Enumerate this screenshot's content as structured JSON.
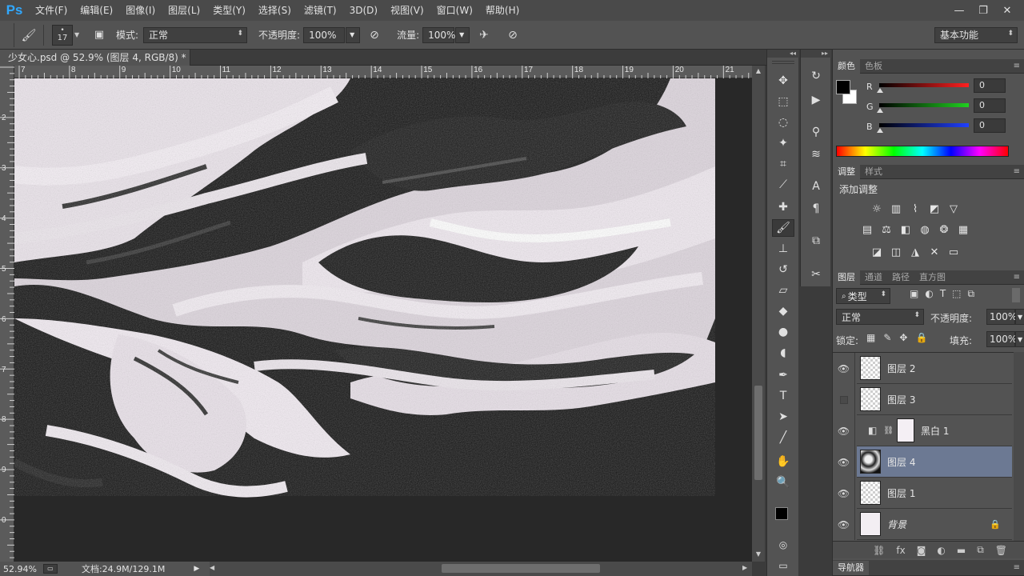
{
  "menu": {
    "logo": "Ps",
    "items": [
      "文件(F)",
      "编辑(E)",
      "图像(I)",
      "图层(L)",
      "类型(Y)",
      "选择(S)",
      "滤镜(T)",
      "3D(D)",
      "视图(V)",
      "窗口(W)",
      "帮助(H)"
    ],
    "window_controls": [
      "—",
      "❐",
      "✕"
    ]
  },
  "options": {
    "brush_size": "17",
    "mode_label": "模式:",
    "mode_value": "正常",
    "opacity_label": "不透明度:",
    "opacity_value": "100%",
    "flow_label": "流量:",
    "flow_value": "100%",
    "workspace_value": "基本功能"
  },
  "document": {
    "tab_title": "少女心.psd @ 52.9% (图层 4, RGB/8) *",
    "close": "×"
  },
  "rulers": {
    "top": [
      "7",
      "8",
      "9",
      "10",
      "11",
      "12",
      "13",
      "14",
      "15",
      "16",
      "17",
      "18",
      "19",
      "20",
      "21"
    ],
    "left": [
      "2",
      "3",
      "4",
      "5",
      "6",
      "7",
      "8",
      "9",
      "0"
    ]
  },
  "status": {
    "zoom": "52.94%",
    "doc": "文档:24.9M/129.1M"
  },
  "color_panel": {
    "tabs": [
      "颜色",
      "色板"
    ],
    "channels": [
      {
        "label": "R",
        "value": "0",
        "color": "#ff2020"
      },
      {
        "label": "G",
        "value": "0",
        "color": "#20d020"
      },
      {
        "label": "B",
        "value": "0",
        "color": "#2040ff"
      }
    ]
  },
  "adjust_panel": {
    "tabs": [
      "调整",
      "样式"
    ],
    "title": "添加调整"
  },
  "layers_panel": {
    "tabs": [
      "图层",
      "通道",
      "路径",
      "直方图"
    ],
    "filter_label": "类型",
    "blend_mode": "正常",
    "opacity_label": "不透明度:",
    "opacity_value": "100%",
    "lock_label": "锁定:",
    "fill_label": "填充:",
    "fill_value": "100%",
    "layers": [
      {
        "name": "图层 2",
        "visible": true,
        "selected": false
      },
      {
        "name": "图层 3",
        "visible": false,
        "selected": false
      },
      {
        "name": "黑白 1",
        "visible": true,
        "selected": false
      },
      {
        "name": "图层 4",
        "visible": true,
        "selected": true
      },
      {
        "name": "图层 1",
        "visible": true,
        "selected": false
      },
      {
        "name": "背景",
        "visible": true,
        "selected": false
      }
    ]
  },
  "navigator": {
    "tab": "导航器"
  }
}
